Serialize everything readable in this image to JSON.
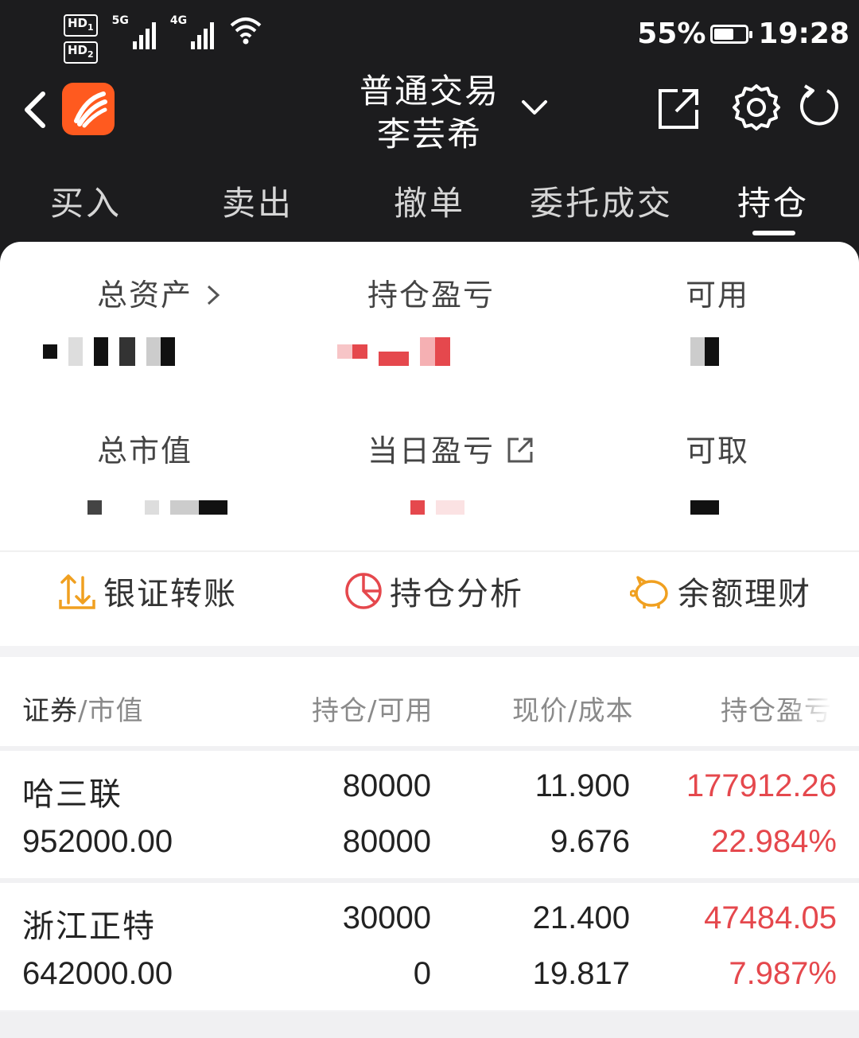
{
  "status_bar": {
    "hd1": "HD",
    "hd1_sub": "1",
    "hd2": "HD",
    "hd2_sub": "2",
    "net1": "5G",
    "net2": "4G",
    "battery": "55%",
    "time": "19:28"
  },
  "header": {
    "title": "普通交易",
    "account_name": "李芸希",
    "logo_color": "#ff5a1f"
  },
  "tabs": [
    {
      "label": "买入"
    },
    {
      "label": "卖出"
    },
    {
      "label": "撤单"
    },
    {
      "label": "委托成交"
    },
    {
      "label": "持仓",
      "active": true
    }
  ],
  "summary": {
    "total_assets_label": "总资产",
    "position_pnl_label": "持仓盈亏",
    "available_label": "可用",
    "market_value_label": "总市值",
    "daily_pnl_label": "当日盈亏",
    "withdrawable_label": "可取"
  },
  "quick_actions": [
    {
      "label": "银证转账",
      "icon": "transfer-icon"
    },
    {
      "label": "持仓分析",
      "icon": "pie-chart-icon"
    },
    {
      "label": "余额理财",
      "icon": "piggy-bank-icon"
    }
  ],
  "holdings_table": {
    "headers": {
      "security": "证券",
      "market_value": "/市值",
      "position_available": "持仓/可用",
      "price_cost": "现价/成本",
      "pnl": "持仓盈亏"
    },
    "rows": [
      {
        "name": "哈三联",
        "market_value": "952000.00",
        "position": "80000",
        "available": "80000",
        "price": "11.900",
        "cost": "9.676",
        "pnl": "177912.26",
        "pnl_pct": "22.984%"
      },
      {
        "name": "浙江正特",
        "market_value": "642000.00",
        "position": "30000",
        "available": "0",
        "price": "21.400",
        "cost": "19.817",
        "pnl": "47484.05",
        "pnl_pct": "7.987%"
      }
    ]
  },
  "colors": {
    "header_bg": "#1c1c1e",
    "profit_red": "#e5484d",
    "accent_gold": "#f0a020"
  }
}
